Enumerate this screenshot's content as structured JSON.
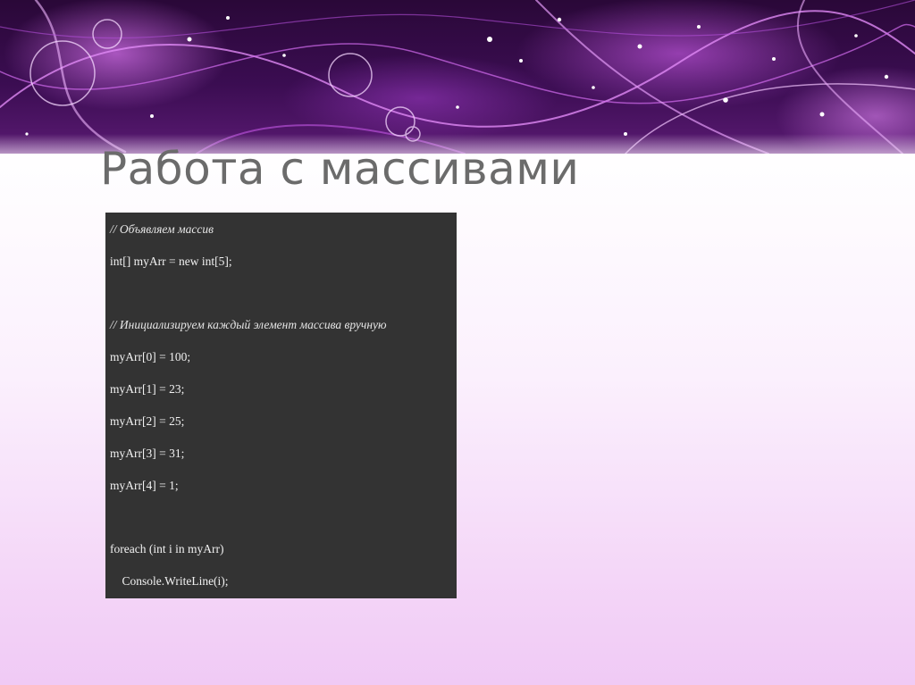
{
  "slide": {
    "title": "Работа с массивами"
  },
  "code": {
    "lines": [
      {
        "text": "// Объявляем массив",
        "kind": "comment"
      },
      {
        "text": "int[] myArr = new int[5];",
        "kind": "code"
      },
      {
        "text": "",
        "kind": "blank"
      },
      {
        "text": "// Инициализируем каждый элемент массива вручную",
        "kind": "comment"
      },
      {
        "text": "myArr[0] = 100;",
        "kind": "code"
      },
      {
        "text": "myArr[1] = 23;",
        "kind": "code"
      },
      {
        "text": "myArr[2] = 25;",
        "kind": "code"
      },
      {
        "text": "myArr[3] = 31;",
        "kind": "code"
      },
      {
        "text": "myArr[4] = 1;",
        "kind": "code"
      },
      {
        "text": "",
        "kind": "blank"
      },
      {
        "text": "foreach (int i in myArr)",
        "kind": "code"
      },
      {
        "text": "    Console.WriteLine(i);",
        "kind": "code"
      }
    ]
  },
  "theme": {
    "banner_color": "#3b0d52",
    "accent_color": "#c86ae6",
    "title_color": "#6b6b6b",
    "code_background": "#333333"
  }
}
